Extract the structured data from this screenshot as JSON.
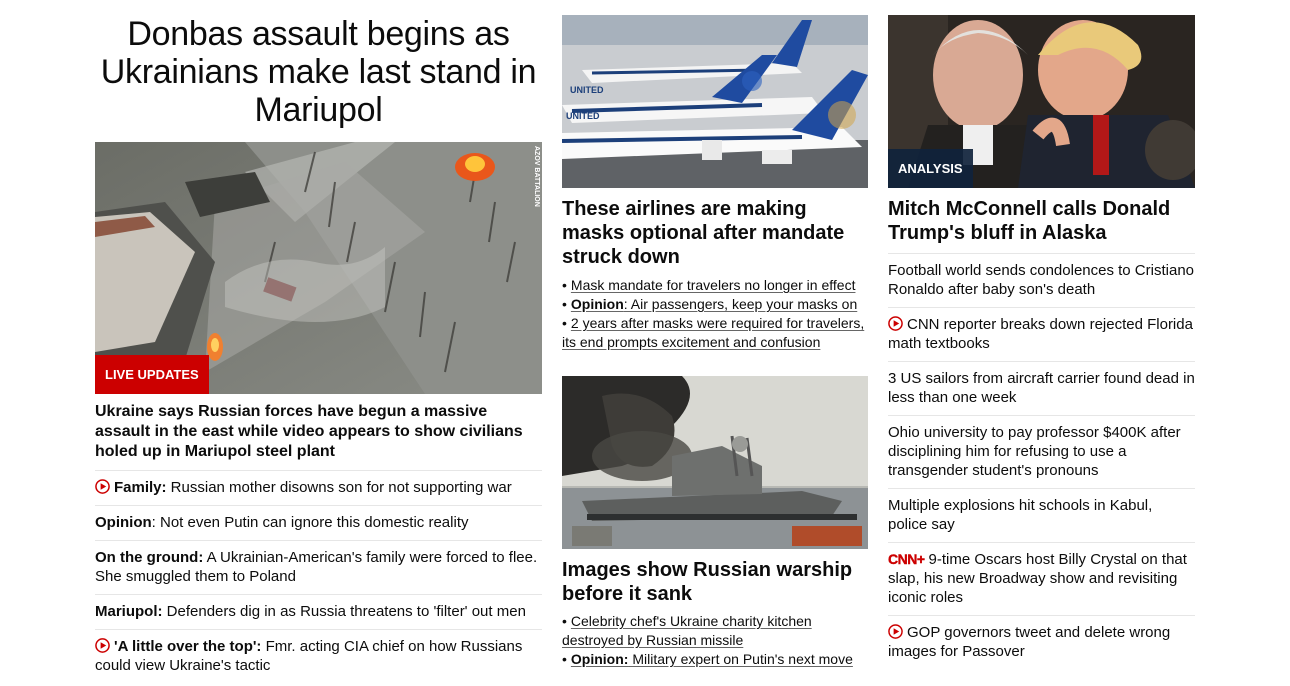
{
  "main": {
    "headline": "Donbas assault begins as Ukrainians make last stand in Mariupol",
    "image": {
      "badge": "LIVE UPDATES",
      "credit": "AZOV BATTALION"
    },
    "lead": "Ukraine says Russian forces have begun a massive assault in the east while video appears to show civilians holed up in Mariupol steel plant",
    "items": [
      {
        "video": true,
        "bold": "Family:",
        "text": " Russian mother disowns son for not supporting war"
      },
      {
        "video": false,
        "bold": "Opinion",
        "text": ": Not even Putin can ignore this domestic reality"
      },
      {
        "video": false,
        "bold": "On the ground:",
        "text": " A Ukrainian-American's family were forced to flee. She smuggled them to Poland"
      },
      {
        "video": false,
        "bold": "Mariupol:",
        "text": " Defenders dig in as Russia threatens to 'filter' out men"
      },
      {
        "video": true,
        "bold": "'A little over the top':",
        "text": " Fmr. acting CIA chief on how Russians could view Ukraine's tactic"
      }
    ]
  },
  "airlines": {
    "title": "These airlines are making masks optional after mandate struck down",
    "bullets": [
      {
        "bold": "",
        "text": "Mask mandate for travelers no longer in effect"
      },
      {
        "bold": "Opinion",
        "text": ": Air passengers, keep your masks on"
      },
      {
        "bold": "",
        "text": "2 years after masks were required for travelers, its end prompts excitement and confusion"
      }
    ]
  },
  "warship": {
    "title": "Images show Russian warship before it sank",
    "bullets": [
      {
        "bold": "",
        "text": "Celebrity chef's Ukraine charity kitchen destroyed by Russian missile"
      },
      {
        "bold": "Opinion:",
        "text": " Military expert on Putin's next move"
      }
    ]
  },
  "mcconnell": {
    "badge": "ANALYSIS",
    "title": "Mitch McConnell calls Donald Trump's bluff in Alaska",
    "items": [
      {
        "icon": "",
        "text": "Football world sends condolences to Cristiano Ronaldo after baby son's death"
      },
      {
        "icon": "play",
        "text": "CNN reporter breaks down rejected Florida math textbooks"
      },
      {
        "icon": "",
        "text": "3 US sailors from aircraft carrier found dead in less than one week"
      },
      {
        "icon": "",
        "text": "Ohio university to pay professor $400K after disciplining him for refusing to use a transgender student's pronouns"
      },
      {
        "icon": "",
        "text": "Multiple explosions hit schools in Kabul, police say"
      },
      {
        "icon": "cnnplus",
        "icon_label": "CNN+",
        "text": "9-time Oscars host Billy Crystal on that slap, his new Broadway show and revisiting iconic roles"
      },
      {
        "icon": "play",
        "text": "GOP governors tweet and delete wrong images for Passover"
      }
    ]
  },
  "colors": {
    "accent_red": "#cc0000",
    "analysis_badge": "#10233c",
    "text": "#0c0c0c",
    "divider": "#e6e6e6"
  }
}
